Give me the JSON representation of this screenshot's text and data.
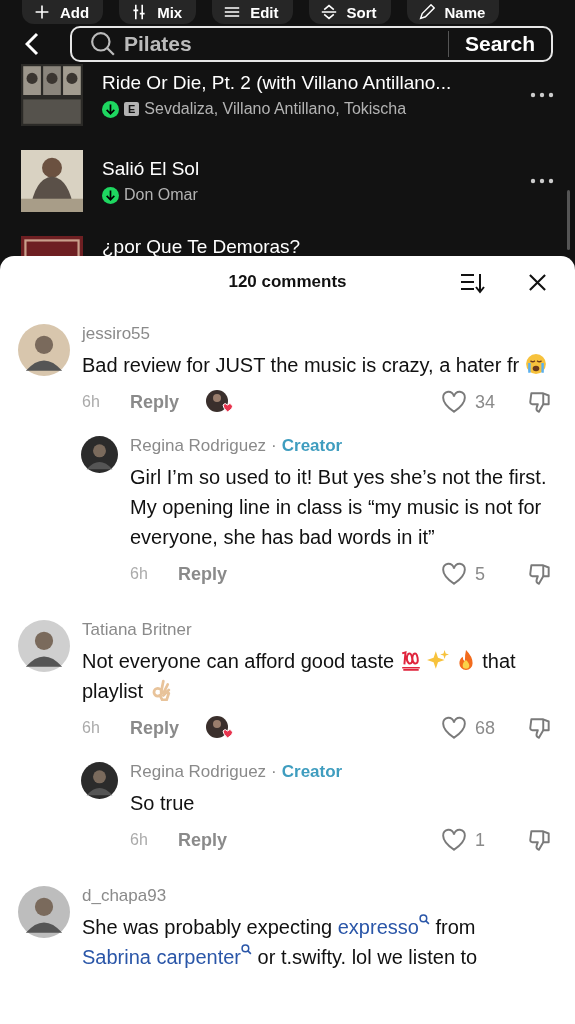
{
  "toolbar": [
    {
      "label": "Add"
    },
    {
      "label": "Mix"
    },
    {
      "label": "Edit"
    },
    {
      "label": "Sort"
    },
    {
      "label": "Name"
    }
  ],
  "search": {
    "value": "Pilates",
    "button": "Search"
  },
  "tracks": [
    {
      "title": "Ride Or Die, Pt. 2 (with Villano Antillano...",
      "artists": "Sevdaliza, Villano Antillano, Tokischa",
      "downloaded": true,
      "explicit": "E"
    },
    {
      "title": "Salió El Sol",
      "artists": "Don Omar",
      "downloaded": true
    },
    {
      "title": "¿por Que Te Demoras?"
    }
  ],
  "comments_sheet": {
    "title": "120 comments",
    "comments": [
      {
        "user": "jessiro55",
        "text": [
          {
            "kind": "text",
            "text": "Bad review for JUST the music is crazy, a hater fr"
          },
          {
            "kind": "crying"
          }
        ],
        "time": "6h",
        "reply": "Reply",
        "liked_by_creator": true,
        "likes": "34",
        "replies": [
          {
            "user": "Regina Rodriguez",
            "separator": "·",
            "badge": "Creator",
            "text": [
              {
                "kind": "text",
                "text": "Girl I’m so used to it! But yes she’s not the first. My opening line in class is “my music is not for everyone, she has bad words in it”"
              }
            ],
            "time": "6h",
            "reply": "Reply",
            "liked_by_creator": false,
            "likes": "5"
          }
        ]
      },
      {
        "user": "Tatiana Britner",
        "text": [
          {
            "kind": "text",
            "text": "Not everyone can afford good taste"
          },
          {
            "kind": "hundred"
          },
          {
            "kind": "sparkles"
          },
          {
            "kind": "fire"
          },
          {
            "kind": "text",
            "text": "that playlist"
          },
          {
            "kind": "ok"
          }
        ],
        "time": "6h",
        "reply": "Reply",
        "liked_by_creator": true,
        "likes": "68",
        "replies": [
          {
            "user": "Regina Rodriguez",
            "separator": "·",
            "badge": "Creator",
            "text": [
              {
                "kind": "text",
                "text": "So true"
              }
            ],
            "time": "6h",
            "reply": "Reply",
            "liked_by_creator": false,
            "likes": "1"
          }
        ]
      },
      {
        "user": "d_chapa93",
        "text": [
          {
            "kind": "text",
            "text": "She was probably expecting"
          },
          {
            "kind": "link",
            "text": "expresso"
          },
          {
            "kind": "text",
            "text": "from"
          },
          {
            "kind": "link",
            "text": "Sabrina carpenter"
          },
          {
            "kind": "text",
            "text": "or t.swifty. lol we listen to"
          }
        ]
      }
    ]
  }
}
